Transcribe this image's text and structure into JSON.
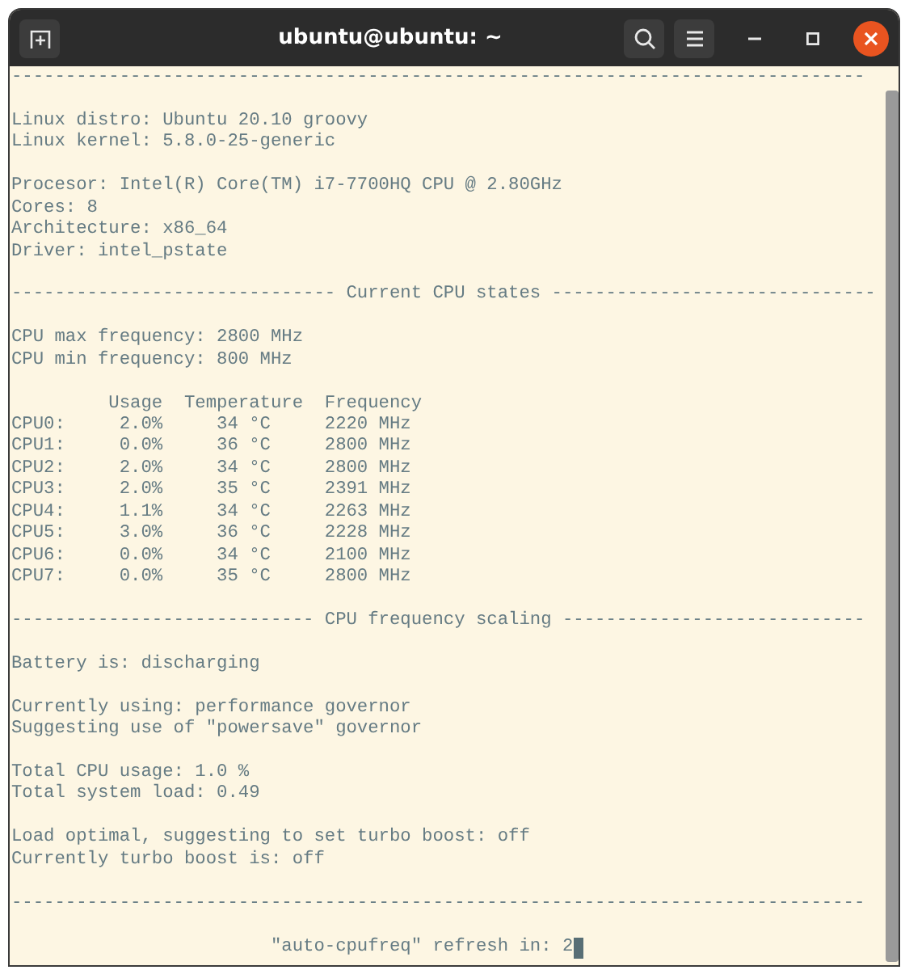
{
  "window": {
    "title": "ubuntu@ubuntu: ~"
  },
  "terminal": {
    "lines": [
      {
        "kind": "rule",
        "text": "-------------------------------------------------------------------------------"
      },
      {
        "kind": "blank"
      },
      {
        "kind": "text",
        "text": "Linux distro: Ubuntu 20.10 groovy"
      },
      {
        "kind": "text",
        "text": "Linux kernel: 5.8.0-25-generic"
      },
      {
        "kind": "blank"
      },
      {
        "kind": "text",
        "text": "Procesor: Intel(R) Core(TM) i7-7700HQ CPU @ 2.80GHz"
      },
      {
        "kind": "text",
        "text": "Cores: 8"
      },
      {
        "kind": "text",
        "text": "Architecture: x86_64"
      },
      {
        "kind": "text",
        "text": "Driver: intel_pstate"
      },
      {
        "kind": "blank"
      },
      {
        "kind": "heading",
        "text": "------------------------------ Current CPU states ------------------------------"
      },
      {
        "kind": "blank"
      },
      {
        "kind": "text",
        "text": "CPU max frequency: 2800 MHz"
      },
      {
        "kind": "text",
        "text": "CPU min frequency: 800 MHz"
      },
      {
        "kind": "blank"
      },
      {
        "kind": "text",
        "text": "         Usage  Temperature  Frequency"
      },
      {
        "kind": "text",
        "text": "CPU0:     2.0%     34 °C     2220 MHz"
      },
      {
        "kind": "text",
        "text": "CPU1:     0.0%     36 °C     2800 MHz"
      },
      {
        "kind": "text",
        "text": "CPU2:     2.0%     34 °C     2800 MHz"
      },
      {
        "kind": "text",
        "text": "CPU3:     2.0%     35 °C     2391 MHz"
      },
      {
        "kind": "text",
        "text": "CPU4:     1.1%     34 °C     2263 MHz"
      },
      {
        "kind": "text",
        "text": "CPU5:     3.0%     36 °C     2228 MHz"
      },
      {
        "kind": "text",
        "text": "CPU6:     0.0%     34 °C     2100 MHz"
      },
      {
        "kind": "text",
        "text": "CPU7:     0.0%     35 °C     2800 MHz"
      },
      {
        "kind": "blank"
      },
      {
        "kind": "heading",
        "text": "---------------------------- CPU frequency scaling ----------------------------"
      },
      {
        "kind": "blank"
      },
      {
        "kind": "text",
        "text": "Battery is: discharging"
      },
      {
        "kind": "blank"
      },
      {
        "kind": "text",
        "text": "Currently using: performance governor"
      },
      {
        "kind": "text",
        "text": "Suggesting use of \"powersave\" governor"
      },
      {
        "kind": "blank"
      },
      {
        "kind": "text",
        "text": "Total CPU usage: 1.0 %"
      },
      {
        "kind": "text",
        "text": "Total system load: 0.49"
      },
      {
        "kind": "blank"
      },
      {
        "kind": "text",
        "text": "Load optimal, suggesting to set turbo boost: off"
      },
      {
        "kind": "text",
        "text": "Currently turbo boost is: off"
      },
      {
        "kind": "blank"
      },
      {
        "kind": "rule",
        "text": "-------------------------------------------------------------------------------"
      },
      {
        "kind": "blank"
      },
      {
        "kind": "text",
        "text": "                        \"auto-cpufreq\" refresh in: 2",
        "cursor": true
      }
    ]
  }
}
